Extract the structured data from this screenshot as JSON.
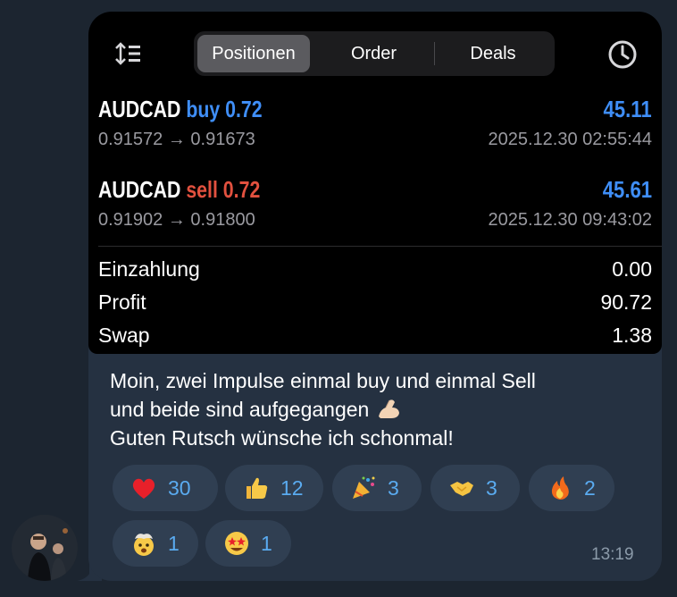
{
  "tabs": {
    "positions": "Positionen",
    "order": "Order",
    "deals": "Deals"
  },
  "positions": [
    {
      "symbol": "AUDCAD",
      "side_volume": "buy 0.72",
      "side": "buy",
      "profit": "45.11",
      "prices": "0.91572 → 0.91673",
      "time": "2025.12.30 02:55:44"
    },
    {
      "symbol": "AUDCAD",
      "side_volume": "sell 0.72",
      "side": "sell",
      "profit": "45.61",
      "prices": "0.91902 → 0.91800",
      "time": "2025.12.30 09:43:02"
    }
  ],
  "summary": [
    {
      "label": "Einzahlung",
      "value": "0.00"
    },
    {
      "label": "Profit",
      "value": "90.72"
    },
    {
      "label": "Swap",
      "value": "1.38"
    }
  ],
  "message": {
    "line1": "Moin, zwei Impulse einmal buy und einmal Sell",
    "line2": "und beide sind aufgegangen",
    "line2_emoji": "flexed-biceps",
    "line3": "Guten Rutsch wünsche ich schonmal!",
    "time": "13:19"
  },
  "reactions": [
    {
      "icon": "red-heart",
      "count": "30"
    },
    {
      "icon": "thumbs-up",
      "count": "12"
    },
    {
      "icon": "party-popper",
      "count": "3"
    },
    {
      "icon": "handshake",
      "count": "3"
    },
    {
      "icon": "fire",
      "count": "2"
    },
    {
      "icon": "exploding-head",
      "count": "1"
    },
    {
      "icon": "star-struck",
      "count": "1"
    }
  ],
  "colors": {
    "chat_bg": "#1c2530",
    "bubble_bg": "#253141",
    "reaction_bg": "#303f52",
    "reaction_text": "#5aabf0",
    "buy": "#3f8ef7",
    "sell": "#e2513f"
  }
}
